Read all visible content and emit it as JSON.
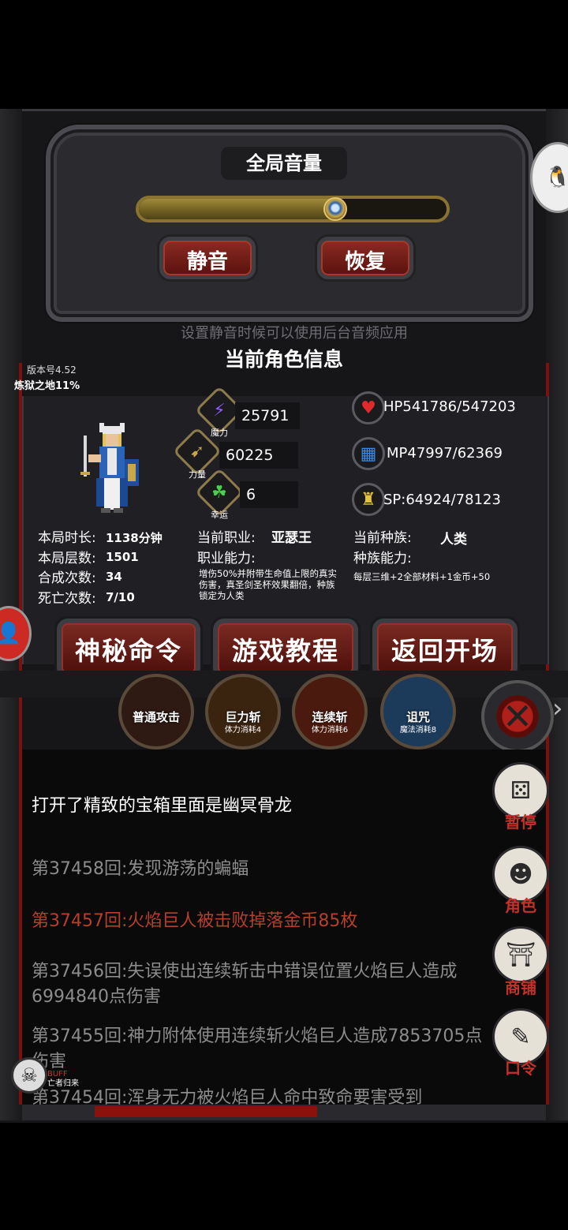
{
  "volume": {
    "title": "全局音量",
    "level": 0.63,
    "mute_label": "静音",
    "restore_label": "恢复",
    "hint": "设置静音时候可以使用后台音频应用"
  },
  "info": {
    "title": "当前角色信息",
    "version": "版本号4.52",
    "progress": "炼狱之地11%",
    "stats": {
      "magic": {
        "value": "25791",
        "caption": "魔力"
      },
      "power": {
        "value": "60225",
        "caption": "力量"
      },
      "luck": {
        "value": "6",
        "caption": "幸运"
      }
    },
    "resources": {
      "hp": "HP541786/547203",
      "mp": "MP47997/62369",
      "sp": "SP:64924/78123"
    },
    "left": {
      "time_label": "本局时长:",
      "time_value": "1138分钟",
      "floors_label": "本局层数:",
      "floors_value": "1501",
      "craft_label": "合成次数:",
      "craft_value": "34",
      "death_label": "死亡次数:",
      "death_value": "7/10"
    },
    "job": {
      "label": "当前职业:",
      "value": "亚瑟王",
      "ability_label": "职业能力:",
      "ability_desc": "增伤50%并附带生命值上限的真实伤害，真圣剑圣杯效果翻倍，种族锁定为人类"
    },
    "race": {
      "label": "当前种族:",
      "value": "人类",
      "ability_label": "种族能力:",
      "ability_desc": "每层三维+2全部材料+1金币+50"
    }
  },
  "buttons": {
    "secret": "神秘命令",
    "tutorial": "游戏教程",
    "back": "返回开场"
  },
  "skills": [
    {
      "name": "普通攻击",
      "cost": ""
    },
    {
      "name": "巨力斩",
      "cost": "体力消耗4"
    },
    {
      "name": "连续斩",
      "cost": "体力消耗6"
    },
    {
      "name": "诅咒",
      "cost": "魔法消耗8"
    }
  ],
  "log": [
    {
      "text": "打开了精致的宝箱里面是幽冥骨龙"
    },
    {
      "text": "第37458回:发现游荡的蝙蝠"
    },
    {
      "text": "第37457回:火焰巨人被击败掉落金币85枚"
    },
    {
      "text": "第37456回:失误使出连续斩击中错误位置火焰巨人造成6994840点伤害"
    },
    {
      "text": "第37455回:神力附体使用连续斩火焰巨人造成7853705点伤害"
    },
    {
      "text": "第37454回:浑身无力被火焰巨人命中致命要害受到"
    }
  ],
  "side_menu": {
    "pause": "暂停",
    "character": "角色",
    "shop": "商铺",
    "code": "口令"
  },
  "buff": {
    "label": "BUFF",
    "name": "亡者归来"
  },
  "colors": {
    "accent_red": "#c5312a",
    "log_red": "#b5402a",
    "gold": "#8a7230"
  }
}
